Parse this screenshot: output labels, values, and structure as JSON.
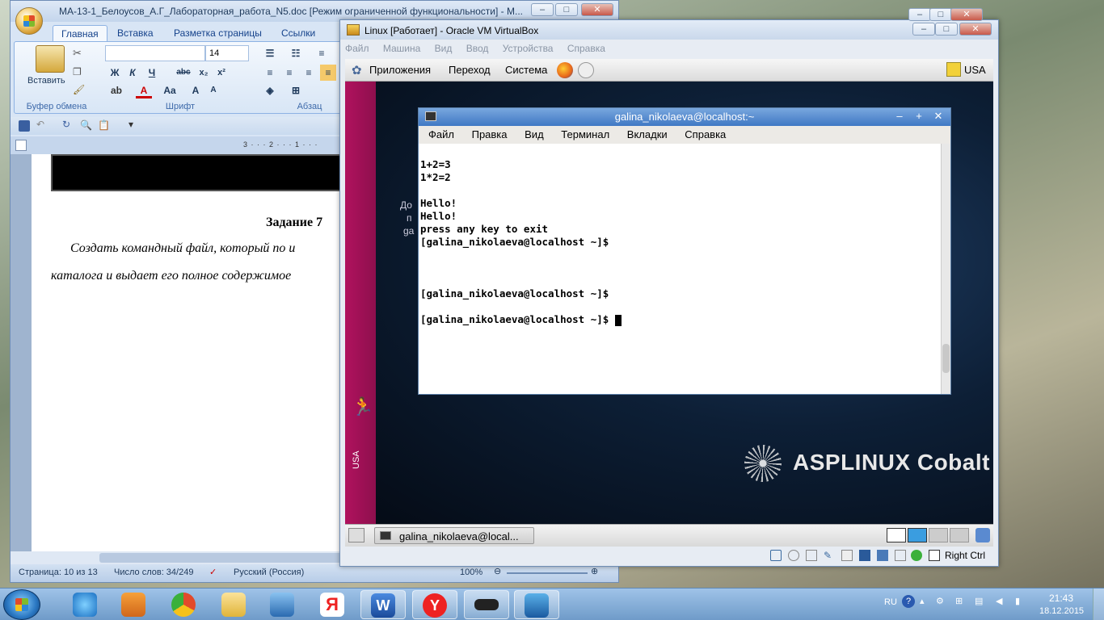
{
  "word": {
    "title": "МА-13-1_Белоусов_А.Г_Лабораторная_работа_N5.doc [Режим ограниченной функциональности] - M...",
    "tabs": [
      "Главная",
      "Вставка",
      "Разметка страницы",
      "Ссылки"
    ],
    "paste_label": "Вставить",
    "groups": {
      "clipboard": "Буфер обмена",
      "font": "Шрифт",
      "paragraph": "Абзац"
    },
    "font_size": "14",
    "font_buttons": [
      "Ж",
      "К",
      "Ч",
      "abc",
      "x₂",
      "x²"
    ],
    "ruler_marks": "3 · · · 2 · · · 1 · · · ",
    "heading": "Задание 7",
    "para_line1": "Создать командный файл, который по и",
    "para_line2": "каталога и выдает его полное содержимое",
    "status": {
      "page": "Страница: 10 из 13",
      "words": "Число слов: 34/249",
      "lang": "Русский (Россия)",
      "zoom": "100%"
    }
  },
  "vbox": {
    "title": "Linux [Работает] - Oracle VM VirtualBox",
    "menu": [
      "Файл",
      "Машина",
      "Вид",
      "Ввод",
      "Устройства",
      "Справка"
    ],
    "gnome_menu": [
      "Приложения",
      "Переход",
      "Система"
    ],
    "kbd_layout": "USA",
    "side_label": "USA",
    "partial_desktop_text": [
      "До",
      "п",
      "ga"
    ],
    "brand": "ASPLINUX Cobalt",
    "taskbar_item": "galina_nikolaeva@local...",
    "host_key": "Right Ctrl"
  },
  "terminal": {
    "title": "galina_nikolaeva@localhost:~",
    "menu": [
      "Файл",
      "Правка",
      "Вид",
      "Терминал",
      "Вкладки",
      "Справка"
    ],
    "lines": [
      "1+2=3",
      "1*2=2",
      "",
      "Hello!",
      "Hello!",
      "press any key to exit",
      "[galina_nikolaeva@localhost ~]$",
      "",
      "",
      "",
      "[galina_nikolaeva@localhost ~]$",
      "",
      "[galina_nikolaeva@localhost ~]$ "
    ]
  },
  "taskbar": {
    "lang": "RU",
    "time": "21:43",
    "date": "18.12.2015"
  },
  "colors": {
    "accent": "#3f78c4",
    "magenta": "#b0125e",
    "word_blue": "#15428b"
  }
}
